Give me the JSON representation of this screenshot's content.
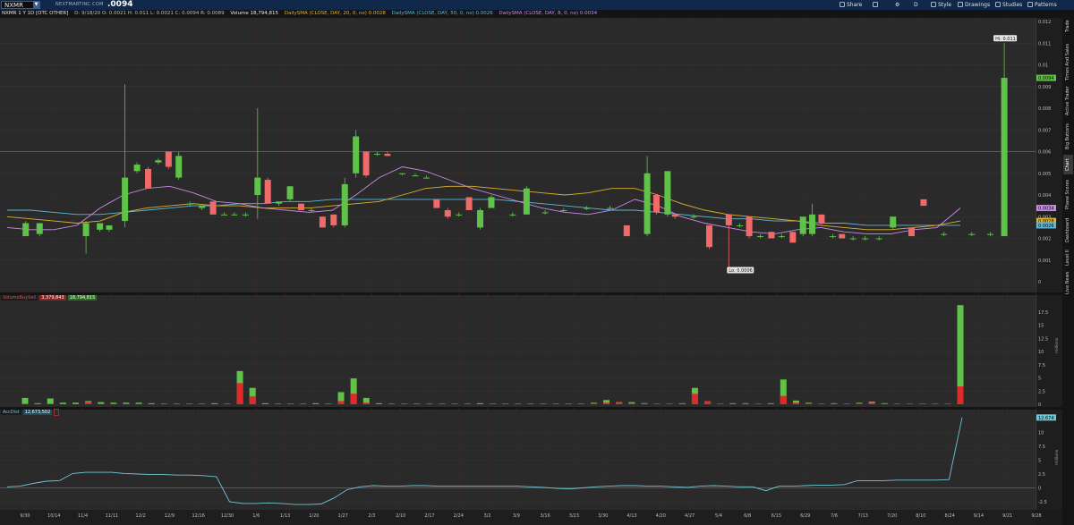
{
  "toolbar": {
    "symbol": "NXMR",
    "site": "NEXTMARTINC.COM",
    "last_price": ".0094",
    "buttons": [
      "Share",
      "D",
      "Style",
      "Drawings",
      "Studies",
      "Patterns"
    ]
  },
  "info": {
    "title": "NXMR 1 Y 1D [OTC OTHER]",
    "ohlc": "D: 9/18/20  O: 0.0021  H: 0.011  L: 0.0021  C: 0.0094  R: 0.0089",
    "volume": "Volume 18,794,815",
    "sma20": "DailySMA (CLOSE, DAY, 20, 0, no) 0.0028",
    "sma50": "DailySMA (CLOSE, DAY, 50, 0, no) 0.0026",
    "sma8": "DailySMA (CLOSE, DAY, 8, 0, no) 0.0034"
  },
  "side_tabs": [
    "Trade",
    "Times And Sales",
    "Active Trader",
    "Big Buttons",
    "Chart",
    "Phase Scores",
    "Dashboard",
    "Level II",
    "Live News"
  ],
  "active_tab": "Chart",
  "volume_label": {
    "name": "VolumeBuySell",
    "sell": "3,379,843",
    "buy": "18,794,815"
  },
  "accdist_label": {
    "name": "AccDist",
    "value": "12,673,502"
  },
  "hi_label": "Hi: 0.011",
  "lo_label": "Lo: 0.0006",
  "price_axis": [
    "0.012",
    "0.011",
    "0.01",
    "0.009",
    "0.008",
    "0.007",
    "0.006",
    "0.005",
    "0.004",
    "0.003",
    "0.002",
    "0.001",
    "0"
  ],
  "price_tags": {
    "last": "0.0094",
    "sma8": "0.0034",
    "sma20": "0.0028",
    "sma50": "0.0026"
  },
  "vol_axis": [
    "17.5",
    "15",
    "12.5",
    "10",
    "7.5",
    "5",
    "2.5",
    "0"
  ],
  "vol_unit": "millions",
  "acc_axis": [
    "10",
    "7.5",
    "5",
    "2.5",
    "0",
    "-2.5"
  ],
  "acc_unit": "millions",
  "acc_tag": "12.674",
  "x_axis": [
    "9/30",
    "10/14",
    "11/4",
    "11/11",
    "12/2",
    "12/9",
    "12/16",
    "12/30",
    "1/6",
    "1/13",
    "1/20",
    "1/27",
    "2/3",
    "2/10",
    "2/17",
    "2/24",
    "3/2",
    "3/9",
    "3/16",
    "3/23",
    "3/30",
    "4/13",
    "4/20",
    "4/27",
    "5/4",
    "6/8",
    "6/15",
    "6/29",
    "7/6",
    "7/13",
    "7/20",
    "8/10",
    "8/24",
    "9/14",
    "9/21",
    "9/28"
  ],
  "colors": {
    "up": "#5fc34a",
    "down": "#f06a6a",
    "sma8": "#c88ae8",
    "sma20": "#e0b030",
    "sma50": "#5fb8d8",
    "acc": "#6fc7d6"
  },
  "chart_data": {
    "type": "candlestick",
    "x_labels": [
      "9/30",
      "10/14",
      "11/4",
      "11/11",
      "12/2",
      "12/9",
      "12/16",
      "12/30",
      "1/6",
      "1/13",
      "1/20",
      "1/27",
      "2/3",
      "2/10",
      "2/17",
      "2/24",
      "3/2",
      "3/9",
      "3/16",
      "3/23",
      "3/30",
      "4/13",
      "4/20",
      "4/27",
      "5/4",
      "6/8",
      "6/15",
      "6/29",
      "7/6",
      "7/13",
      "7/20",
      "8/10",
      "8/24",
      "9/14",
      "9/21",
      "9/28"
    ],
    "candles": [
      {
        "x": 0.02,
        "o": 0.0021,
        "c": 0.0027,
        "h": 0.0028,
        "l": 0.0021
      },
      {
        "x": 0.035,
        "o": 0.0022,
        "c": 0.0027,
        "h": 0.0027,
        "l": 0.0021
      },
      {
        "x": 0.085,
        "o": 0.0021,
        "c": 0.0027,
        "h": 0.0028,
        "l": 0.0013
      },
      {
        "x": 0.1,
        "o": 0.0024,
        "c": 0.0027,
        "h": 0.0027,
        "l": 0.0023
      },
      {
        "x": 0.11,
        "o": 0.0024,
        "c": 0.0026,
        "h": 0.0026,
        "l": 0.0023
      },
      {
        "x": 0.127,
        "o": 0.0028,
        "c": 0.0048,
        "h": 0.0091,
        "l": 0.0025
      },
      {
        "x": 0.14,
        "o": 0.0051,
        "c": 0.0054,
        "h": 0.0055,
        "l": 0.005
      },
      {
        "x": 0.152,
        "o": 0.0052,
        "c": 0.0043,
        "h": 0.0053,
        "l": 0.0043
      },
      {
        "x": 0.163,
        "o": 0.0055,
        "c": 0.0056,
        "h": 0.0057,
        "l": 0.0054
      },
      {
        "x": 0.174,
        "o": 0.006,
        "c": 0.0053,
        "h": 0.006,
        "l": 0.0052
      },
      {
        "x": 0.185,
        "o": 0.0048,
        "c": 0.0058,
        "h": 0.006,
        "l": 0.0047
      },
      {
        "x": 0.197,
        "o": 0.0036,
        "c": 0.0036,
        "h": 0.0037,
        "l": 0.0035
      },
      {
        "x": 0.21,
        "o": 0.0034,
        "c": 0.0035,
        "h": 0.0035,
        "l": 0.0033
      },
      {
        "x": 0.222,
        "o": 0.0037,
        "c": 0.0031,
        "h": 0.0037,
        "l": 0.0031
      },
      {
        "x": 0.234,
        "o": 0.0031,
        "c": 0.0031,
        "h": 0.0032,
        "l": 0.0031
      },
      {
        "x": 0.245,
        "o": 0.0031,
        "c": 0.0031,
        "h": 0.0032,
        "l": 0.0031
      },
      {
        "x": 0.257,
        "o": 0.0031,
        "c": 0.0031,
        "h": 0.0032,
        "l": 0.003
      },
      {
        "x": 0.27,
        "o": 0.004,
        "c": 0.0048,
        "h": 0.008,
        "l": 0.0029
      },
      {
        "x": 0.281,
        "o": 0.0047,
        "c": 0.0036,
        "h": 0.0048,
        "l": 0.0036
      },
      {
        "x": 0.293,
        "o": 0.0036,
        "c": 0.0037,
        "h": 0.0037,
        "l": 0.0035
      },
      {
        "x": 0.305,
        "o": 0.0038,
        "c": 0.0044,
        "h": 0.0044,
        "l": 0.0037
      },
      {
        "x": 0.317,
        "o": 0.0036,
        "c": 0.0033,
        "h": 0.0036,
        "l": 0.0033
      },
      {
        "x": 0.328,
        "o": 0.0033,
        "c": 0.0033,
        "h": 0.0034,
        "l": 0.0032
      },
      {
        "x": 0.34,
        "o": 0.003,
        "c": 0.0025,
        "h": 0.003,
        "l": 0.0025
      },
      {
        "x": 0.352,
        "o": 0.0031,
        "c": 0.0026,
        "h": 0.0031,
        "l": 0.0025
      },
      {
        "x": 0.364,
        "o": 0.0026,
        "c": 0.0045,
        "h": 0.0048,
        "l": 0.0025
      },
      {
        "x": 0.376,
        "o": 0.005,
        "c": 0.0067,
        "h": 0.007,
        "l": 0.0048
      },
      {
        "x": 0.387,
        "o": 0.006,
        "c": 0.0049,
        "h": 0.006,
        "l": 0.0048
      },
      {
        "x": 0.399,
        "o": 0.0059,
        "c": 0.0059,
        "h": 0.006,
        "l": 0.0058
      },
      {
        "x": 0.41,
        "o": 0.0059,
        "c": 0.0058,
        "h": 0.006,
        "l": 0.0058
      },
      {
        "x": 0.426,
        "o": 0.005,
        "c": 0.005,
        "h": 0.005,
        "l": 0.0049
      },
      {
        "x": 0.44,
        "o": 0.0049,
        "c": 0.0049,
        "h": 0.005,
        "l": 0.0049
      },
      {
        "x": 0.452,
        "o": 0.0048,
        "c": 0.0048,
        "h": 0.0049,
        "l": 0.0048
      },
      {
        "x": 0.463,
        "o": 0.0038,
        "c": 0.0034,
        "h": 0.0038,
        "l": 0.0034
      },
      {
        "x": 0.475,
        "o": 0.0033,
        "c": 0.003,
        "h": 0.0034,
        "l": 0.0029
      },
      {
        "x": 0.487,
        "o": 0.0031,
        "c": 0.0031,
        "h": 0.0032,
        "l": 0.003
      },
      {
        "x": 0.498,
        "o": 0.0039,
        "c": 0.0033,
        "h": 0.0039,
        "l": 0.0033
      },
      {
        "x": 0.51,
        "o": 0.0025,
        "c": 0.0033,
        "h": 0.0034,
        "l": 0.0024
      },
      {
        "x": 0.522,
        "o": 0.0034,
        "c": 0.0039,
        "h": 0.004,
        "l": 0.0034
      },
      {
        "x": 0.545,
        "o": 0.0031,
        "c": 0.0031,
        "h": 0.0032,
        "l": 0.003
      },
      {
        "x": 0.56,
        "o": 0.0031,
        "c": 0.0043,
        "h": 0.0044,
        "l": 0.0031
      },
      {
        "x": 0.58,
        "o": 0.0032,
        "c": 0.0032,
        "h": 0.0033,
        "l": 0.0031
      },
      {
        "x": 0.6,
        "o": 0.0033,
        "c": 0.0033,
        "h": 0.0034,
        "l": 0.0032
      },
      {
        "x": 0.625,
        "o": 0.0034,
        "c": 0.0034,
        "h": 0.0035,
        "l": 0.0033
      },
      {
        "x": 0.65,
        "o": 0.0034,
        "c": 0.0034,
        "h": 0.0035,
        "l": 0.0033
      },
      {
        "x": 0.668,
        "o": 0.0026,
        "c": 0.0021,
        "h": 0.0026,
        "l": 0.0021
      },
      {
        "x": 0.69,
        "o": 0.0022,
        "c": 0.005,
        "h": 0.0058,
        "l": 0.0021
      },
      {
        "x": 0.7,
        "o": 0.004,
        "c": 0.0032,
        "h": 0.004,
        "l": 0.0031
      },
      {
        "x": 0.712,
        "o": 0.0031,
        "c": 0.0051,
        "h": 0.0051,
        "l": 0.003
      },
      {
        "x": 0.72,
        "o": 0.0031,
        "c": 0.003,
        "h": 0.0031,
        "l": 0.0029
      },
      {
        "x": 0.74,
        "o": 0.003,
        "c": 0.003,
        "h": 0.0031,
        "l": 0.0029
      },
      {
        "x": 0.757,
        "o": 0.0026,
        "c": 0.0016,
        "h": 0.0026,
        "l": 0.0015
      },
      {
        "x": 0.778,
        "o": 0.0031,
        "c": 0.0026,
        "h": 0.0031,
        "l": 0.0006
      },
      {
        "x": 0.79,
        "o": 0.0026,
        "c": 0.0026,
        "h": 0.0027,
        "l": 0.0025
      },
      {
        "x": 0.8,
        "o": 0.003,
        "c": 0.0021,
        "h": 0.003,
        "l": 0.002
      },
      {
        "x": 0.812,
        "o": 0.0021,
        "c": 0.0021,
        "h": 0.0022,
        "l": 0.002
      },
      {
        "x": 0.824,
        "o": 0.0023,
        "c": 0.002,
        "h": 0.0023,
        "l": 0.002
      },
      {
        "x": 0.835,
        "o": 0.0021,
        "c": 0.0021,
        "h": 0.0022,
        "l": 0.002
      },
      {
        "x": 0.847,
        "o": 0.0023,
        "c": 0.0018,
        "h": 0.0023,
        "l": 0.0018
      },
      {
        "x": 0.858,
        "o": 0.0022,
        "c": 0.003,
        "h": 0.003,
        "l": 0.0021
      },
      {
        "x": 0.868,
        "o": 0.0022,
        "c": 0.0031,
        "h": 0.0036,
        "l": 0.0021
      },
      {
        "x": 0.878,
        "o": 0.0031,
        "c": 0.0027,
        "h": 0.0031,
        "l": 0.0026
      },
      {
        "x": 0.89,
        "o": 0.0021,
        "c": 0.0021,
        "h": 0.0022,
        "l": 0.002
      },
      {
        "x": 0.9,
        "o": 0.0022,
        "c": 0.002,
        "h": 0.0022,
        "l": 0.002
      },
      {
        "x": 0.912,
        "o": 0.002,
        "c": 0.002,
        "h": 0.0021,
        "l": 0.0019
      },
      {
        "x": 0.925,
        "o": 0.002,
        "c": 0.002,
        "h": 0.0021,
        "l": 0.0019
      },
      {
        "x": 0.94,
        "o": 0.002,
        "c": 0.002,
        "h": 0.0021,
        "l": 0.0019
      },
      {
        "x": 0.955,
        "o": 0.0025,
        "c": 0.003,
        "h": 0.003,
        "l": 0.0024
      },
      {
        "x": 0.975,
        "o": 0.0025,
        "c": 0.0021,
        "h": 0.0025,
        "l": 0.0021
      },
      {
        "x": 0.988,
        "o": 0.0038,
        "c": 0.0035,
        "h": 0.0038,
        "l": 0.0035
      },
      {
        "x": 1.01,
        "o": 0.0022,
        "c": 0.0022,
        "h": 0.0023,
        "l": 0.0021
      },
      {
        "x": 1.04,
        "o": 0.0022,
        "c": 0.0022,
        "h": 0.0023,
        "l": 0.0021
      },
      {
        "x": 1.06,
        "o": 0.0022,
        "c": 0.0022,
        "h": 0.0023,
        "l": 0.0021
      },
      {
        "x": 1.075,
        "o": 0.0021,
        "c": 0.0094,
        "h": 0.011,
        "l": 0.0021
      }
    ],
    "volume_m": [
      1.2,
      0.2,
      1.1,
      0.3,
      0.3,
      0.6,
      0.4,
      0.3,
      0.3,
      0.3,
      0.2,
      0.1,
      0.1,
      0.1,
      0.1,
      0.2,
      0.1,
      6.3,
      3.1,
      0.2,
      0.1,
      0.1,
      0.1,
      0.2,
      0.1,
      2.3,
      4.9,
      1.2,
      0.2,
      0.1,
      0.1,
      0.1,
      0.1,
      0.1,
      0.1,
      0.1,
      0.2,
      0.1,
      0.1,
      0.1,
      0.1,
      0.1,
      0.1,
      0.1,
      0.1,
      0.3,
      0.8,
      0.4,
      0.4,
      0.2,
      0.1,
      0.1,
      0.2,
      3.1,
      0.6,
      0.1,
      0.2,
      0.2,
      0.1,
      0.2,
      4.7,
      0.7,
      0.3,
      0.1,
      0.2,
      0.1,
      0.3,
      0.5,
      0.2,
      0.1,
      0.1,
      0.1,
      0.1,
      0.1,
      18.8
    ],
    "volume_sell_m": [
      0.1,
      0.05,
      0.1,
      0.05,
      0.05,
      0.4,
      0.1,
      0.1,
      0.1,
      0.1,
      0.05,
      0.02,
      0.02,
      0.02,
      0.02,
      0.05,
      0.02,
      4.0,
      1.5,
      0.05,
      0.02,
      0.02,
      0.02,
      0.05,
      0.02,
      0.6,
      2.0,
      0.3,
      0.05,
      0.02,
      0.02,
      0.02,
      0.02,
      0.02,
      0.02,
      0.02,
      0.05,
      0.02,
      0.02,
      0.02,
      0.02,
      0.02,
      0.02,
      0.02,
      0.02,
      0.2,
      0.3,
      0.3,
      0.2,
      0.1,
      0.05,
      0.05,
      0.1,
      2.0,
      0.6,
      0.05,
      0.1,
      0.1,
      0.05,
      0.1,
      1.6,
      0.3,
      0.2,
      0.05,
      0.1,
      0.05,
      0.2,
      0.3,
      0.1,
      0.05,
      0.05,
      0.05,
      0.05,
      0.05,
      3.38
    ],
    "sma20": [
      0.003,
      0.0029,
      0.0028,
      0.0027,
      0.0028,
      0.0032,
      0.0034,
      0.0035,
      0.0036,
      0.0035,
      0.0035,
      0.0034,
      0.0034,
      0.0034,
      0.0035,
      0.0036,
      0.0037,
      0.004,
      0.0043,
      0.0044,
      0.0044,
      0.0043,
      0.0042,
      0.0041,
      0.004,
      0.0041,
      0.0043,
      0.0043,
      0.004,
      0.0036,
      0.0033,
      0.0031,
      0.003,
      0.0029,
      0.0028,
      0.0026,
      0.0025,
      0.0024,
      0.0024,
      0.0025,
      0.0026,
      0.0028
    ],
    "sma50": [
      0.0033,
      0.0033,
      0.0032,
      0.0031,
      0.0031,
      0.0032,
      0.0033,
      0.0034,
      0.0035,
      0.0035,
      0.0036,
      0.0036,
      0.0037,
      0.0037,
      0.0038,
      0.0038,
      0.0038,
      0.0038,
      0.0038,
      0.0038,
      0.0038,
      0.0038,
      0.0037,
      0.0036,
      0.0035,
      0.0034,
      0.0033,
      0.0033,
      0.0032,
      0.0031,
      0.003,
      0.0029,
      0.0029,
      0.0028,
      0.0028,
      0.0027,
      0.0027,
      0.0026,
      0.0026,
      0.0026,
      0.0026,
      0.0026
    ],
    "sma8": [
      0.0025,
      0.0024,
      0.0024,
      0.0026,
      0.0034,
      0.004,
      0.0043,
      0.0044,
      0.0041,
      0.0037,
      0.0036,
      0.0034,
      0.0033,
      0.0032,
      0.0033,
      0.004,
      0.0048,
      0.0053,
      0.0051,
      0.0047,
      0.0043,
      0.004,
      0.0037,
      0.0034,
      0.0032,
      0.0031,
      0.0033,
      0.0038,
      0.0035,
      0.003,
      0.0027,
      0.0025,
      0.0023,
      0.0022,
      0.0024,
      0.0025,
      0.0023,
      0.0022,
      0.0022,
      0.0024,
      0.0025,
      0.0034
    ],
    "accdist_m": [
      0.2,
      0.3,
      0.8,
      1.2,
      1.3,
      2.6,
      2.8,
      2.8,
      2.8,
      2.6,
      2.5,
      2.4,
      2.4,
      2.3,
      2.3,
      2.2,
      2.0,
      -2.5,
      -2.8,
      -2.8,
      -2.7,
      -2.8,
      -3.0,
      -3.0,
      -2.9,
      -1.8,
      -0.3,
      0.2,
      0.4,
      0.3,
      0.3,
      0.4,
      0.4,
      0.3,
      0.3,
      0.3,
      0.3,
      0.3,
      0.3,
      0.3,
      0.2,
      0.1,
      -0.1,
      -0.2,
      0.0,
      0.2,
      0.3,
      0.4,
      0.4,
      0.3,
      0.3,
      0.2,
      0.1,
      0.3,
      0.4,
      0.3,
      0.2,
      0.2,
      -0.5,
      0.3,
      0.3,
      0.4,
      0.5,
      0.5,
      0.6,
      1.3,
      1.3,
      1.3,
      1.4,
      1.4,
      1.4,
      1.4,
      1.5,
      12.67
    ],
    "price_ylim": [
      0,
      0.012
    ],
    "volume_ylim": [
      0,
      19
    ],
    "accdist_ylim": [
      -3.3,
      12.8
    ]
  }
}
